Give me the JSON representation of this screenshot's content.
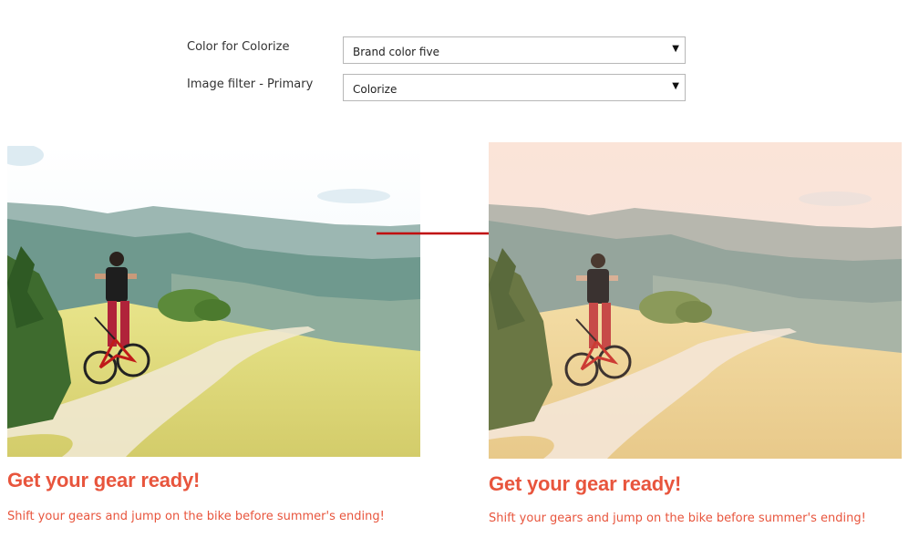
{
  "form": {
    "colorize_label": "Color for Colorize",
    "colorize_value": "Brand color five",
    "filter_label": "Image filter - Primary",
    "filter_value": "Colorize",
    "caret": "▼"
  },
  "cards": {
    "original": {
      "headline": "Get your gear ready!",
      "subline": "Shift your gears and jump on the bike before summer's ending!"
    },
    "filtered": {
      "headline": "Get your gear ready!",
      "subline": "Shift your gears and jump on the bike before summer's ending!"
    }
  },
  "colors": {
    "accent": "#e8553d",
    "arrow": "#c0090c",
    "colorize_tint": "#ffc9a8"
  },
  "icons": {
    "dropdown": "chevron-down-icon",
    "arrow": "arrow-right-icon"
  }
}
